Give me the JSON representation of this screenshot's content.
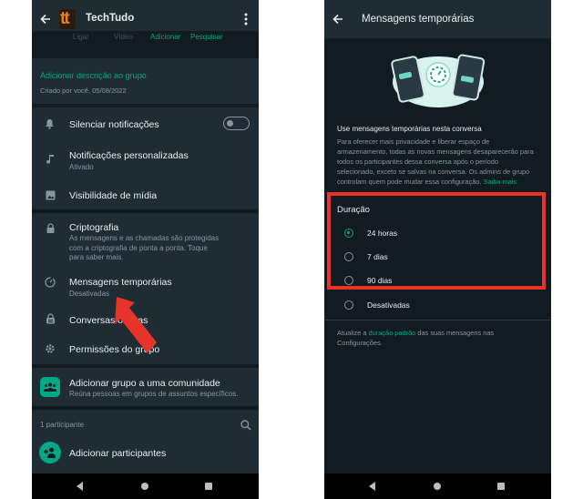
{
  "left": {
    "app_logo": "tt",
    "title": "TechTudo",
    "actions": [
      "Ligar",
      "Vídeo",
      "Adicionar",
      "Pesquisar"
    ],
    "add_description": "Adicionar descrição ao grupo",
    "created_by": "Criado por você, 05/08/2022",
    "mute": {
      "label": "Silenciar notificações",
      "on": false
    },
    "custom_notifications": {
      "title": "Notificações personalizadas",
      "sub": "Ativado"
    },
    "media_visibility": "Visibilidade de mídia",
    "encryption": {
      "title": "Criptografia",
      "sub": "As mensagens e as chamadas são protegidas com a criptografia de ponta a ponta. Toque para saber mais."
    },
    "temporary": {
      "title": "Mensagens temporárias",
      "sub": "Desativadas"
    },
    "locked_chats": "Conversas ocultas",
    "group_permissions": "Permissões do grupo",
    "community": {
      "title": "Adicionar grupo a uma comunidade",
      "sub": "Reúna pessoas em grupos de assuntos específicos."
    },
    "participants_count": "1 participante",
    "add_participants": "Adicionar participantes"
  },
  "right": {
    "title": "Mensagens temporárias",
    "use_label": "Use mensagens temporárias nesta conversa",
    "description": "Para oferecer mais privacidade e liberar espaço de armazenamento, todas as novas mensagens desaparecerão para todos os participantes dessa conversa após o período selecionado, exceto se salvas na conversa. Os admins de grupo controlam quem pode mudar essa configuração.",
    "learn_more": "Saiba mais",
    "duration_label": "Duração",
    "options": [
      {
        "label": "24 horas",
        "selected": true
      },
      {
        "label": "7 dias",
        "selected": false
      },
      {
        "label": "90 dias",
        "selected": false
      },
      {
        "label": "Desativadas",
        "selected": false
      }
    ],
    "footer_pre": "Atualize a ",
    "footer_link": "duração padrão",
    "footer_post": " das suas mensagens nas Configurações."
  },
  "colors": {
    "background": "#111b21",
    "surface": "#1f2c33",
    "accent": "#00a884",
    "highlight": "#e8332a",
    "arrow": "#e8332a"
  }
}
